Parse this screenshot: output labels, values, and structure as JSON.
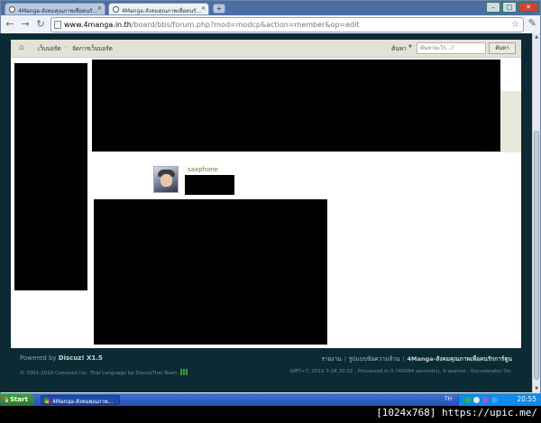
{
  "browser": {
    "tabs": [
      {
        "label": "4Manga-สังคมคุณภาพเพื่อคนรั..."
      },
      {
        "label": "4Manga-สังคมคุณภาพเพื่อคนรั..."
      }
    ],
    "new_tab_glyph": "+",
    "url": {
      "host": "www.4manga.in.th",
      "path": "/board/bbs/forum.php?mod=modcp&action=member&op=edit"
    }
  },
  "page": {
    "breadcrumb": {
      "home": "เว็บบอร์ด",
      "current": "จัดการเว็บบอร์ด"
    },
    "search": {
      "label": "ค้นหา",
      "placeholder": "ค้นหาอะไร...?",
      "button": "ค้นหา"
    },
    "member": {
      "username": "saxphone"
    }
  },
  "footer": {
    "powered_prefix": "Powered by ",
    "powered_brand": "Discuz! X1.5",
    "copyright": "© 2001-2010 Comsenz Inc. Thai Language by DiscuzThai Team.",
    "links": [
      "รายงาน",
      "รูปแบบข้อความล้วน"
    ],
    "brand_link": "4Manga-สังคมคุณภาพเพื่อคนรักการ์ตูน",
    "stats": "GMT+7, 2011-7-24 20:32 , Processed in 0.740084 second(s), 9 queries , Eaccelerator On."
  },
  "taskbar": {
    "start": "Start",
    "task": "4Manga-สังคมคุณภาพ...",
    "lang": "TH",
    "clock": "20:55"
  },
  "caption": "[1024x768] https://upic.me/",
  "colors": {
    "page_bg": "#0c2a33",
    "navbar": "#e2e2d6",
    "username": "#6a7a3a"
  }
}
